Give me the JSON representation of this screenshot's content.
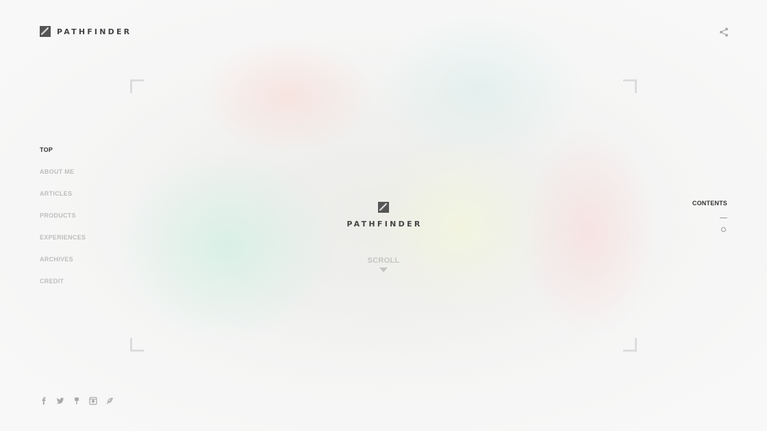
{
  "header": {
    "brand": "PATHFINDER",
    "logo_icon": "pathfinder-stairs-icon",
    "share_icon": "share-icon"
  },
  "side_nav": {
    "items": [
      {
        "label": "TOP",
        "active": true
      },
      {
        "label": "ABOUT ME",
        "active": false
      },
      {
        "label": "ARTICLES",
        "active": false
      },
      {
        "label": "PRODUCTS",
        "active": false
      },
      {
        "label": "EXPERIENCES",
        "active": false
      },
      {
        "label": "ARCHIVES",
        "active": false
      },
      {
        "label": "CREDIT",
        "active": false
      }
    ]
  },
  "hero": {
    "title": "PATHFINDER",
    "scroll_label": "SCROLL",
    "scroll_icon": "caret-down-icon"
  },
  "contents_nav": {
    "label": "CONTENTS"
  },
  "social": {
    "icons": [
      "facebook-icon",
      "twitter-icon",
      "pin-icon",
      "instagram-icon",
      "feather-icon"
    ]
  },
  "colors": {
    "text_dark": "#333333",
    "text_muted": "#bdbdbd",
    "logo_fill": "#555555",
    "background": "#f6f6f6"
  }
}
